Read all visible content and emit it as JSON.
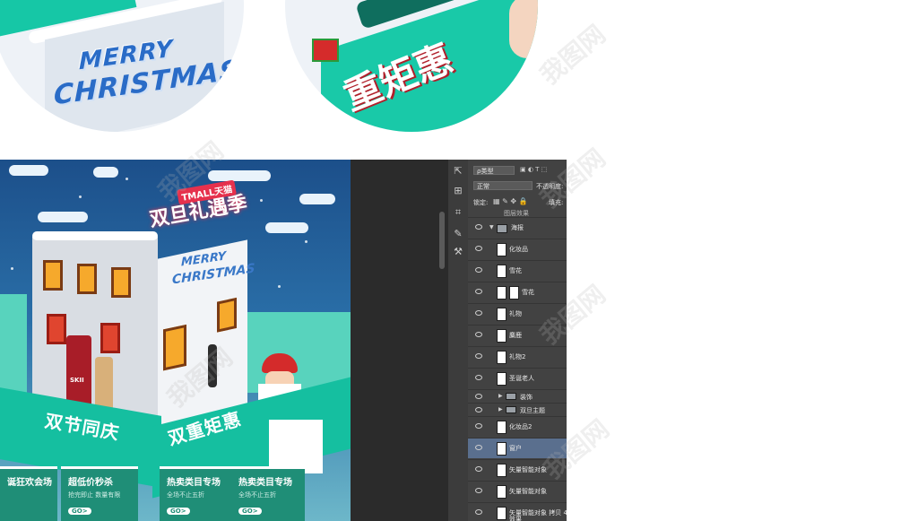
{
  "preview_top": {
    "left_circle": {
      "line1": "MERRY",
      "line2": "CHRISTMAS"
    },
    "right_circle": {
      "promo": "重矩惠"
    }
  },
  "poster": {
    "brand_badge": "TMALL天猫",
    "title": "双旦礼遇季",
    "merry": "MERRY",
    "christmas": "CHRISTMAS",
    "product_label": "SKII",
    "banner_left": "双节同庆",
    "banner_right": "双重矩惠",
    "categories": [
      {
        "title": "诞狂欢会场",
        "sub": "",
        "price": ""
      },
      {
        "title": "超低价秒杀",
        "sub": "抢完即止 数量有限",
        "price": "GO>"
      },
      {
        "title": "热卖类目专场",
        "sub": "全场不止五折",
        "price": "GO>"
      },
      {
        "title": "热卖类目专场",
        "sub": "全场不止五折",
        "price": "GO>"
      }
    ]
  },
  "photoshop": {
    "tools": [
      "⇱",
      "⊞",
      "⌗",
      "✎",
      "⚒"
    ],
    "filter_kind": "ρ类型",
    "blend_mode": "正常",
    "opacity_label": "不透明度:",
    "lock_label": "锁定:",
    "fill_label": "填充:",
    "top_cutoff": "图层效果",
    "layers": [
      {
        "name": "海报",
        "type": "group-open"
      },
      {
        "name": "化妆品",
        "type": "layer"
      },
      {
        "name": "雪花",
        "type": "layer"
      },
      {
        "name": "雪花",
        "type": "masked"
      },
      {
        "name": "礼物",
        "type": "layer"
      },
      {
        "name": "麋鹿",
        "type": "layer"
      },
      {
        "name": "礼物2",
        "type": "layer"
      },
      {
        "name": "圣诞老人",
        "type": "layer"
      },
      {
        "name": "装饰",
        "type": "group-closed"
      },
      {
        "name": "双旦主题",
        "type": "group-closed"
      },
      {
        "name": "化妆品2",
        "type": "layer"
      },
      {
        "name": "窗户",
        "type": "layer",
        "selected": true
      },
      {
        "name": "矢量智能对象",
        "type": "layer"
      },
      {
        "name": "矢量智能对象",
        "type": "layer"
      },
      {
        "name": "矢量智能对象 拷贝 4",
        "type": "layer"
      }
    ],
    "effects_label": "效果"
  },
  "watermark": "我图网",
  "colors": {
    "teal": "#15bfa0",
    "ps_panel": "#424242",
    "selected_layer": "#5a6f8e",
    "accent_red": "#e6314d"
  }
}
